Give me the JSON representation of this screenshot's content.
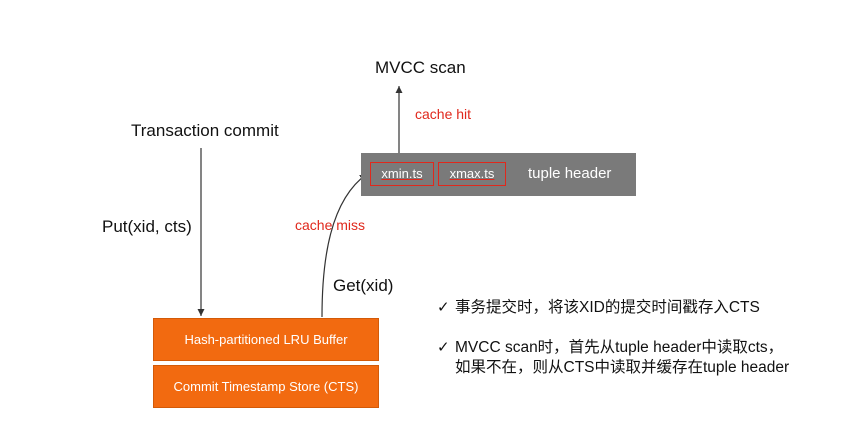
{
  "nodes": {
    "mvcc_scan": "MVCC scan",
    "transaction_commit": "Transaction commit",
    "hash_buffer": "Hash-partitioned LRU Buffer",
    "cts_store": "Commit Timestamp Store (CTS)"
  },
  "tuple_header": {
    "xmin": "xmin.ts",
    "xmax": "xmax.ts",
    "label": "tuple header"
  },
  "edges": {
    "cache_hit": "cache hit",
    "cache_miss": "cache miss",
    "put": "Put(xid, cts)",
    "get": "Get(xid)"
  },
  "notes": [
    {
      "lines": [
        "事务提交时，将该XID的提交时间戳存入CTS"
      ]
    },
    {
      "lines": [
        "MVCC scan时，首先从tuple header中读取cts，",
        "如果不在，则从CTS中读取并缓存在tuple header"
      ]
    }
  ],
  "check_icon": "✓",
  "colors": {
    "orange": "#f26a10",
    "red": "#e0281c",
    "gray": "#7a7a7a"
  }
}
